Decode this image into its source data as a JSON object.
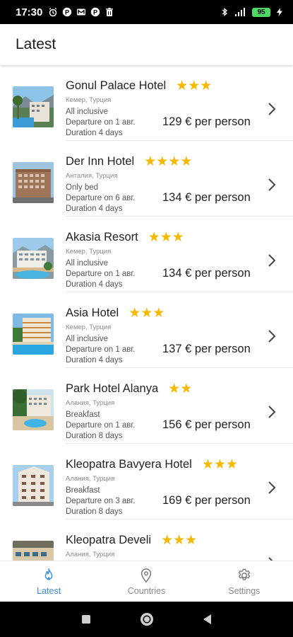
{
  "status_bar": {
    "time": "17:30",
    "left_icons": [
      "alarm-icon",
      "parking-p-icon",
      "mail-m-icon",
      "parking-p-icon",
      "trash-icon"
    ],
    "right_icons": [
      "bluetooth-icon",
      "signal-icon",
      "battery-icon",
      "charging-icon"
    ],
    "battery": "95"
  },
  "app_bar": {
    "title": "Latest"
  },
  "hotels": [
    {
      "name": "Gonul Palace Hotel",
      "stars": "★★★",
      "location": "Кемер, Турция",
      "meal": "All inclusive",
      "departure": "Departure on 1 авг.",
      "duration": "Duration 4 days",
      "price": "129 € per person"
    },
    {
      "name": "Der Inn Hotel",
      "stars": "★★★★",
      "location": "Анталия, Турция",
      "meal": "Only bed",
      "departure": "Departure on 6 авг.",
      "duration": "Duration 4 days",
      "price": "134 € per person"
    },
    {
      "name": "Akasia Resort",
      "stars": "★★★",
      "location": "Кемер, Турция",
      "meal": "All inclusive",
      "departure": "Departure on 1 авг.",
      "duration": "Duration 4 days",
      "price": "134 € per person"
    },
    {
      "name": "Asia Hotel",
      "stars": "★★★",
      "location": "Кемер, Турция",
      "meal": "All inclusive",
      "departure": "Departure on 1 авг.",
      "duration": "Duration 4 days",
      "price": "137 € per person"
    },
    {
      "name": "Park Hotel Alanya",
      "stars": "★★",
      "location": "Алания, Турция",
      "meal": "Breakfast",
      "departure": "Departure on 1 авг.",
      "duration": "Duration 8 days",
      "price": "156 € per person"
    },
    {
      "name": "Kleopatra Bavyera Hotel",
      "stars": "★★★",
      "location": "Алания, Турция",
      "meal": "Breakfast",
      "departure": "Departure on 3 авг.",
      "duration": "Duration 8 days",
      "price": "169 € per person"
    },
    {
      "name": "Kleopatra Develi",
      "stars": "★★★",
      "location": "Алания, Турция",
      "meal": "",
      "departure": "",
      "duration": "",
      "price": ""
    }
  ],
  "bottom_nav": {
    "items": [
      {
        "label": "Latest",
        "icon": "flame-icon",
        "active": true
      },
      {
        "label": "Countries",
        "icon": "location-pin-icon",
        "active": false
      },
      {
        "label": "Settings",
        "icon": "gear-icon",
        "active": false
      }
    ]
  },
  "colors": {
    "accent": "#3a8fe8",
    "star": "#f7b900",
    "status_bar": "#000000",
    "battery": "#4cd964"
  }
}
